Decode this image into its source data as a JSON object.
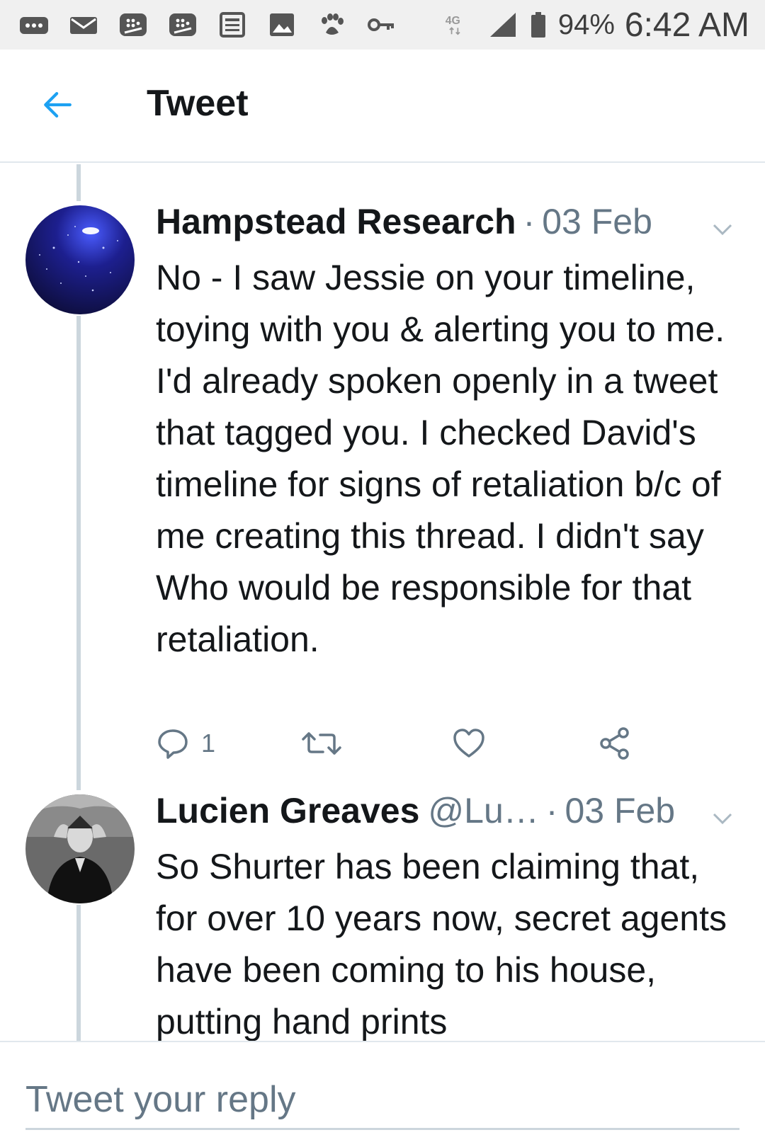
{
  "status_bar": {
    "icons_left": [
      "more-icon",
      "mail-icon",
      "blackberry-icon",
      "blackberry-icon-2",
      "news-icon",
      "image-icon",
      "paw-icon",
      "key-icon"
    ],
    "network": "4G",
    "battery_pct": "94%",
    "time": "6:42 AM"
  },
  "header": {
    "title": "Tweet",
    "accent_color": "#1da1f2"
  },
  "tweets": [
    {
      "author": "Hampstead Research",
      "handle": "",
      "separator": "·",
      "date": "03 Feb",
      "text": "No - I saw Jessie on your timeline, toying with you & alerting you to me. I'd already spoken openly in a tweet that tagged you. I checked David's timeline for signs of retaliation b/c of me creating this thread. I didn't say Who would be responsible for that retaliation.",
      "reply_count": "1"
    },
    {
      "author": "Lucien Greaves",
      "handle": "@Lu…",
      "separator": "·",
      "date": "03 Feb",
      "text": "So Shurter has been claiming that, for over 10 years now, secret agents have been coming to his house, putting hand prints"
    }
  ],
  "reply": {
    "placeholder": "Tweet your reply"
  }
}
